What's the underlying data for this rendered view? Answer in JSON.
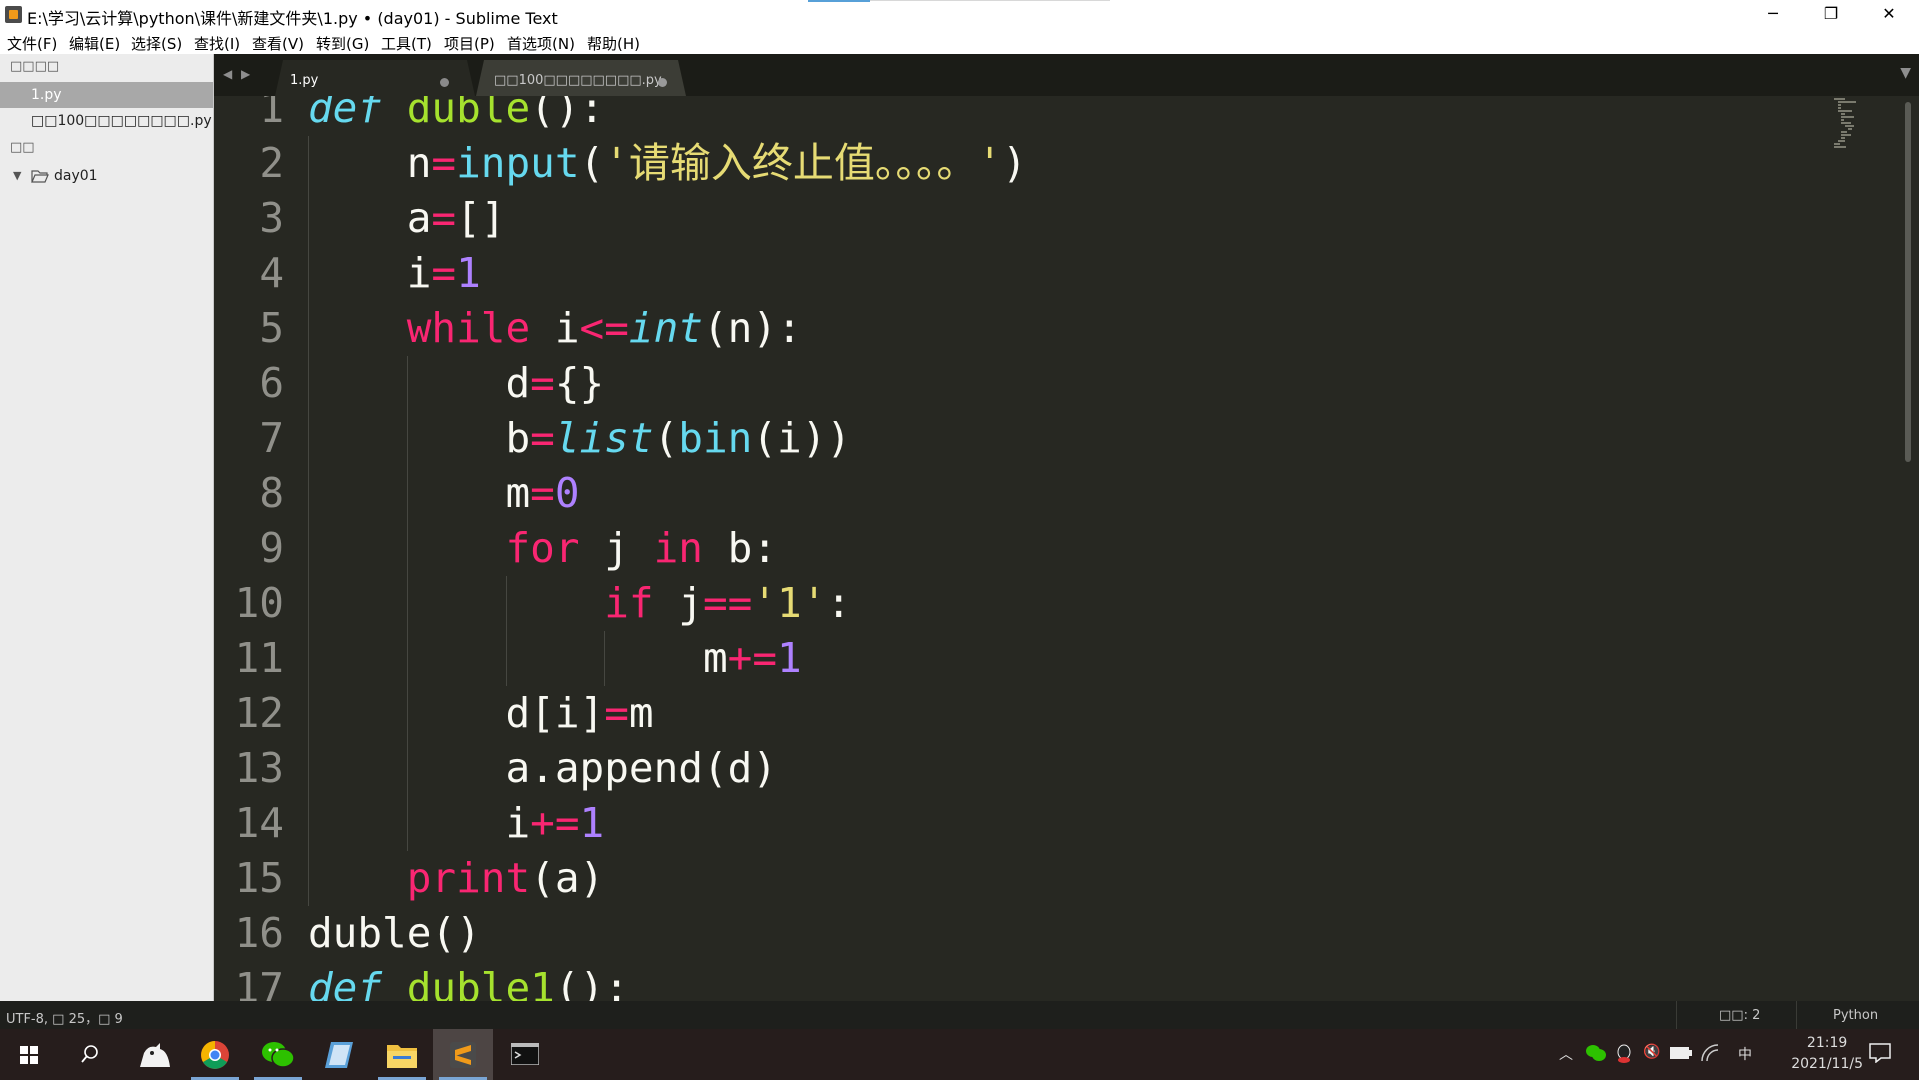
{
  "window": {
    "title": "E:\\学习\\云计算\\python\\课件\\新建文件夹\\1.py • (day01) - Sublime Text",
    "minimize_glyph": "─",
    "maximize_glyph": "❐",
    "close_glyph": "✕"
  },
  "menu": [
    "文件(F)",
    "编辑(E)",
    "选择(S)",
    "查找(I)",
    "查看(V)",
    "转到(G)",
    "工具(T)",
    "项目(P)",
    "首选项(N)",
    "帮助(H)"
  ],
  "sidebar": {
    "open_files_header": "□□□□",
    "open_files": [
      "1.py",
      "□□100□□□□□□□□.py"
    ],
    "folders_header": "□□",
    "folder": "day01"
  },
  "tabs": [
    {
      "label": "1.py",
      "active": true
    },
    {
      "label": "□□100□□□□□□□□.py",
      "active": false
    }
  ],
  "editor": {
    "line_numbers": [
      "1",
      "2",
      "3",
      "4",
      "5",
      "6",
      "7",
      "8",
      "9",
      "10",
      "11",
      "12",
      "13",
      "14",
      "15",
      "16",
      "17"
    ],
    "lines": [
      {
        "t": [
          [
            "def",
            "def"
          ],
          [
            " ",
            ""
          ],
          [
            "duble",
            "fn"
          ],
          [
            "():",
            ""
          ]
        ]
      },
      {
        "t": [
          [
            "    n",
            ""
          ],
          [
            "=",
            "op"
          ],
          [
            "input",
            "bi"
          ],
          [
            "(",
            ""
          ],
          [
            "'请输入终止值。。。。'",
            "str"
          ],
          [
            ")",
            ""
          ]
        ]
      },
      {
        "t": [
          [
            "    a",
            ""
          ],
          [
            "=",
            "op"
          ],
          [
            "[]",
            ""
          ]
        ]
      },
      {
        "t": [
          [
            "    i",
            ""
          ],
          [
            "=",
            "op"
          ],
          [
            "1",
            "num"
          ]
        ]
      },
      {
        "t": [
          [
            "    ",
            ""
          ],
          [
            "while",
            "kw"
          ],
          [
            " i",
            ""
          ],
          [
            "<=",
            "op"
          ],
          [
            "int",
            "ty"
          ],
          [
            "(n):",
            ""
          ]
        ]
      },
      {
        "t": [
          [
            "        d",
            ""
          ],
          [
            "=",
            "op"
          ],
          [
            "{}",
            ""
          ]
        ]
      },
      {
        "t": [
          [
            "        b",
            ""
          ],
          [
            "=",
            "op"
          ],
          [
            "list",
            "ty"
          ],
          [
            "(",
            ""
          ],
          [
            "bin",
            "bi"
          ],
          [
            "(i))",
            ""
          ]
        ]
      },
      {
        "t": [
          [
            "        m",
            ""
          ],
          [
            "=",
            "op"
          ],
          [
            "0",
            "num"
          ]
        ]
      },
      {
        "t": [
          [
            "        ",
            ""
          ],
          [
            "for",
            "kw"
          ],
          [
            " j ",
            ""
          ],
          [
            "in",
            "kw"
          ],
          [
            " b:",
            ""
          ]
        ]
      },
      {
        "t": [
          [
            "            ",
            ""
          ],
          [
            "if",
            "kw"
          ],
          [
            " j",
            ""
          ],
          [
            "==",
            "op"
          ],
          [
            "'1'",
            "str"
          ],
          [
            ":",
            ""
          ]
        ]
      },
      {
        "t": [
          [
            "                m",
            ""
          ],
          [
            "+=",
            "op"
          ],
          [
            "1",
            "num"
          ]
        ]
      },
      {
        "t": [
          [
            "        d[i]",
            ""
          ],
          [
            "=",
            "op"
          ],
          [
            "m",
            ""
          ]
        ]
      },
      {
        "t": [
          [
            "        a.append(d)",
            ""
          ]
        ]
      },
      {
        "t": [
          [
            "        i",
            ""
          ],
          [
            "+=",
            "op"
          ],
          [
            "1",
            "num"
          ]
        ]
      },
      {
        "t": [
          [
            "    ",
            ""
          ],
          [
            "print",
            "kw"
          ],
          [
            "(a)",
            ""
          ]
        ]
      },
      {
        "t": [
          [
            "duble()",
            ""
          ]
        ]
      },
      {
        "t": [
          [
            "def",
            "def"
          ],
          [
            " ",
            ""
          ],
          [
            "duble1",
            "fn"
          ],
          [
            "():",
            ""
          ]
        ]
      }
    ]
  },
  "statusbar": {
    "left": "UTF-8, □ 25，□ 9",
    "indent": "□□: 2",
    "syntax": "Python"
  },
  "taskbar": {
    "time": "21:19",
    "date": "2021/11/5"
  },
  "colors": {
    "editor_bg": "#272822",
    "keyword": "#f92672",
    "function": "#a6e22e",
    "builtin": "#66d9ef",
    "string": "#e6db74",
    "number": "#ae81ff"
  }
}
